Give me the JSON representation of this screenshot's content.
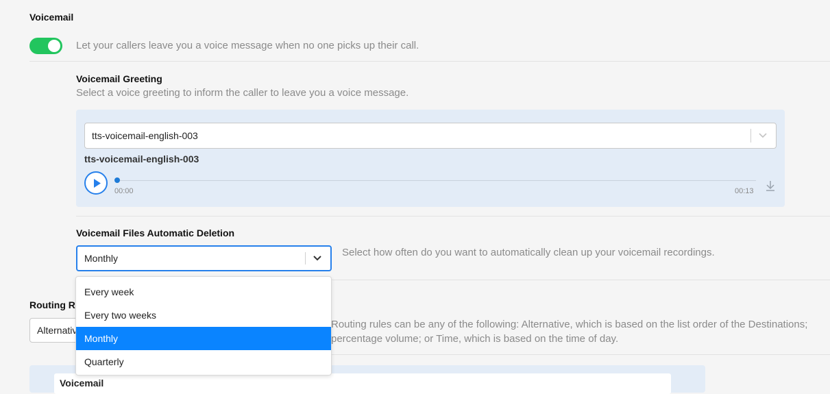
{
  "voicemail": {
    "title": "Voicemail",
    "toggle_on": true,
    "toggle_description": "Let your callers leave you a voice message when no one picks up their call."
  },
  "greeting": {
    "title": "Voicemail Greeting",
    "description": "Select a voice greeting to inform the caller to leave you a voice message.",
    "selected": "tts-voicemail-english-003",
    "player_title": "tts-voicemail-english-003",
    "current_time": "00:00",
    "duration": "00:13",
    "progress": 0
  },
  "deletion": {
    "title": "Voicemail Files Automatic Deletion",
    "selected": "Monthly",
    "description": "Select how often do you want to automatically clean up your voicemail recordings.",
    "options": [
      "Every week",
      "Every two weeks",
      "Monthly",
      "Quarterly"
    ],
    "selected_index": 2
  },
  "routing": {
    "title_partial": "Routing Ru",
    "select_partial": "Alternativ",
    "description_line1": "Routing rules can be any of the following: Alternative, which is based on the list order of the Destinations;",
    "description_line2": "percentage volume; or Time, which is based on the time of day."
  },
  "bottom": {
    "partial_label": "Voicemail"
  },
  "colors": {
    "toggle": "#22c55e",
    "accent": "#0a84ff",
    "card_bg": "#e3ecf7"
  }
}
